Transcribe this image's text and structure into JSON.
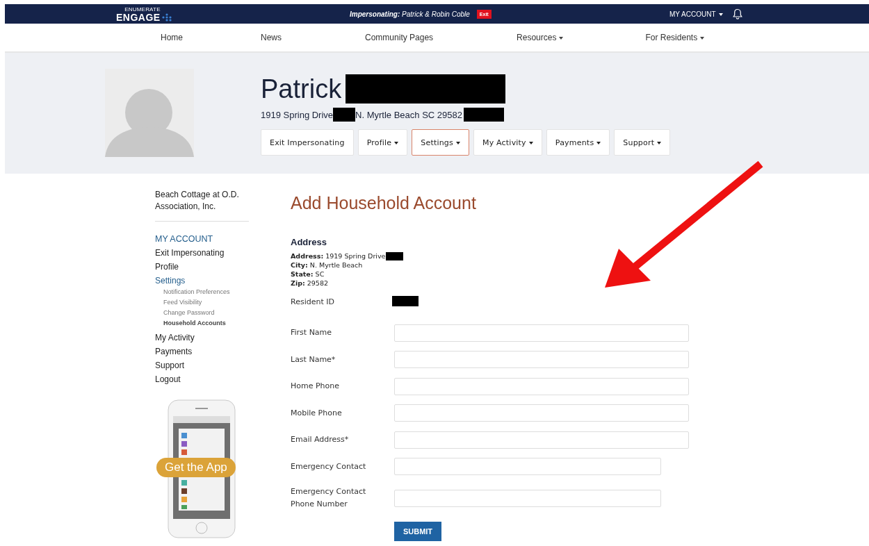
{
  "topbar": {
    "logo_small": "ENUMERATE",
    "logo": "ENGAGE",
    "impersonating_label": "Impersonating:",
    "impersonating_name": "Patrick & Robin Coble",
    "exit": "Exit",
    "account": "MY ACCOUNT"
  },
  "nav": [
    {
      "label": "Home",
      "dropdown": false
    },
    {
      "label": "News",
      "dropdown": false
    },
    {
      "label": "Community Pages",
      "dropdown": false
    },
    {
      "label": "Resources",
      "dropdown": true
    },
    {
      "label": "For Residents",
      "dropdown": true
    }
  ],
  "profile": {
    "first_name": "Patrick",
    "address_parts": [
      "1919 Spring Drive",
      "N. Myrtle Beach SC 29582"
    ],
    "buttons": [
      {
        "label": "Exit Impersonating",
        "dropdown": false,
        "selected": false
      },
      {
        "label": "Profile",
        "dropdown": true,
        "selected": false
      },
      {
        "label": "Settings",
        "dropdown": true,
        "selected": true
      },
      {
        "label": "My Activity",
        "dropdown": true,
        "selected": false
      },
      {
        "label": "Payments",
        "dropdown": true,
        "selected": false
      },
      {
        "label": "Support",
        "dropdown": true,
        "selected": false
      }
    ]
  },
  "sidebar": {
    "association": "Beach Cottage at O.D. Association, Inc.",
    "heading": "MY ACCOUNT",
    "items": [
      {
        "label": "Exit Impersonating",
        "selected": false
      },
      {
        "label": "Profile",
        "selected": false
      },
      {
        "label": "Settings",
        "selected": true,
        "children": [
          {
            "label": "Notification Preferences",
            "selected": false
          },
          {
            "label": "Feed Visibility",
            "selected": false
          },
          {
            "label": "Change Password",
            "selected": false
          },
          {
            "label": "Household Accounts",
            "selected": true
          }
        ]
      },
      {
        "label": "My Activity",
        "selected": false
      },
      {
        "label": "Payments",
        "selected": false
      },
      {
        "label": "Support",
        "selected": false
      },
      {
        "label": "Logout",
        "selected": false
      }
    ],
    "app_promo": "Get the App"
  },
  "main": {
    "title": "Add Household Account",
    "address_heading": "Address",
    "address_lines": [
      "**Address:** 1919 Spring Drive",
      "**City:** N. Myrtle Beach",
      "**State:** SC",
      "**Zip:** 29582"
    ],
    "resident_id_label": "Resident ID",
    "fields": [
      {
        "label": "First Name",
        "kind": "wide"
      },
      {
        "label": "Last Name*",
        "kind": "wide"
      },
      {
        "label": "Home Phone",
        "kind": "wide"
      },
      {
        "label": "Mobile Phone",
        "kind": "wide"
      },
      {
        "label": "Email Address*",
        "kind": "wide"
      },
      {
        "label": "Emergency Contact",
        "kind": "narrow"
      },
      {
        "label": "Emergency Contact Phone Number",
        "kind": "narrow"
      }
    ],
    "submit": "SUBMIT"
  }
}
